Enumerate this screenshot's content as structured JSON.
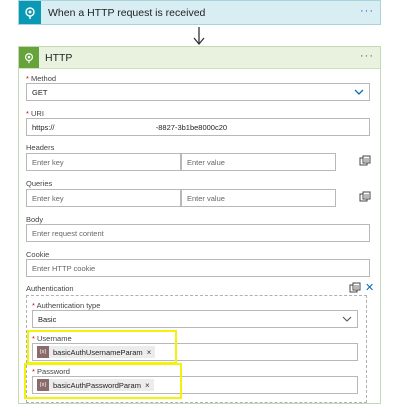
{
  "trigger": {
    "title": "When a HTTP request is received",
    "menu": "···"
  },
  "action": {
    "title": "HTTP",
    "menu": "···",
    "method": {
      "label": "Method",
      "required": "*",
      "value": "GET"
    },
    "uri": {
      "label": "URI",
      "required": "*",
      "value": "https://                           -8827-3b1be8000c20"
    },
    "headers": {
      "label": "Headers",
      "key_placeholder": "Enter key",
      "value_placeholder": "Enter value"
    },
    "queries": {
      "label": "Queries",
      "key_placeholder": "Enter key",
      "value_placeholder": "Enter value"
    },
    "body": {
      "label": "Body",
      "placeholder": "Enter request content"
    },
    "cookie": {
      "label": "Cookie",
      "placeholder": "Enter HTTP cookie"
    },
    "authentication": {
      "label": "Authentication",
      "type": {
        "label": "Authentication type",
        "required": "*",
        "value": "Basic"
      },
      "username": {
        "label": "Username",
        "required": "*",
        "token": "basicAuthUsernameParam",
        "token_icon": "{x}",
        "remove": "×"
      },
      "password": {
        "label": "Password",
        "required": "*",
        "token": "basicAuthPasswordParam",
        "token_icon": "{x}",
        "remove": "×"
      },
      "close": "✕"
    }
  },
  "colors": {
    "trigger_accent": "#0a99b5",
    "http_accent": "#66a33a",
    "highlight": "#f2f20a",
    "link": "#0a6db5"
  }
}
